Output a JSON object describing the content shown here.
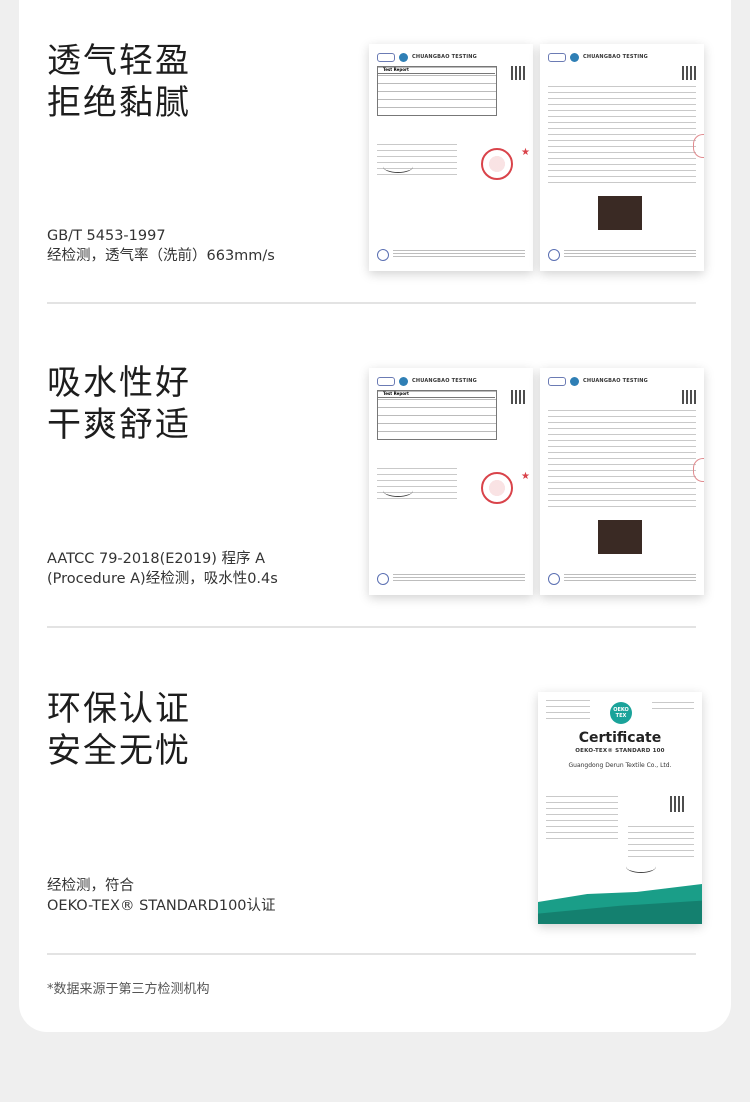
{
  "sections": [
    {
      "headline_line1": "透气轻盈",
      "headline_line2": "拒绝黏腻",
      "detail_line1": "GB/T 5453-1997",
      "detail_line2": "经检测，透气率（洗前）663mm/s"
    },
    {
      "headline_line1": "吸水性好",
      "headline_line2": "干爽舒适",
      "detail_line1": "AATCC 79-2018(E2019) 程序 A",
      "detail_line2": "(Procedure A)经检测，吸水性0.4s"
    },
    {
      "headline_line1": "环保认证",
      "headline_line2": "安全无忧",
      "detail_line1": "经检测，符合",
      "detail_line2": "OEKO-TEX® STANDARD100认证"
    }
  ],
  "documents": {
    "lab_name": "CHUANGBAO TESTING",
    "report_title": "Test Report",
    "certificate": {
      "badge": "OEKO TEX",
      "title": "Certificate",
      "standard": "OEKO-TEX® STANDARD 100",
      "company": "Guangdong Derun Textile Co., Ltd."
    }
  },
  "footnote": "*数据来源于第三方检测机构"
}
